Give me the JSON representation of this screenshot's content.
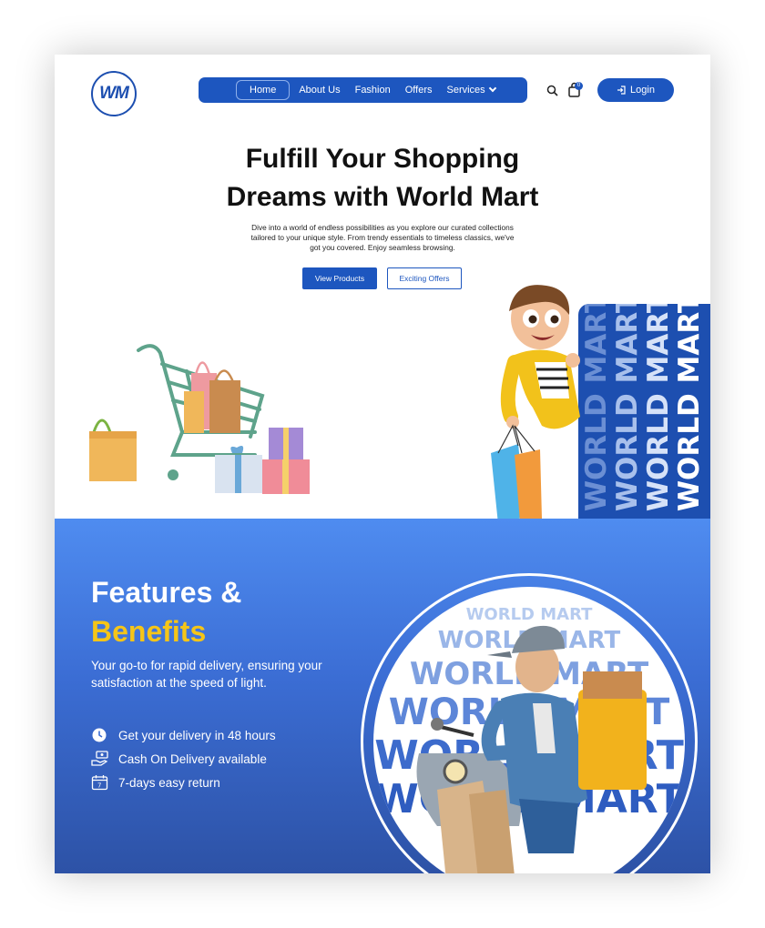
{
  "brand": {
    "logo_text": "WM",
    "primary": "#1d56bf",
    "accent": "#f5c518"
  },
  "nav": {
    "items": [
      {
        "label": "Home",
        "active": true
      },
      {
        "label": "About Us"
      },
      {
        "label": "Fashion"
      },
      {
        "label": "Offers"
      },
      {
        "label": "Services",
        "dropdown": true
      }
    ],
    "cart_count": "0",
    "login_label": "Login"
  },
  "hero": {
    "title_line1": "Fulfill Your Shopping",
    "title_line2": "Dreams with World Mart",
    "subtitle": "Dive into a world of endless possibilities as you explore our curated collections tailored to your unique style. From trendy essentials to timeless classics, we've got you covered. Enjoy seamless browsing.",
    "primary_button": "View Products",
    "secondary_button": "Exciting Offers",
    "banner_word": "WORLD MART"
  },
  "features": {
    "title_white": "Features &",
    "title_yellow": "Benefits",
    "description": "Your go-to for rapid delivery, ensuring your satisfaction at the speed of light.",
    "items": [
      {
        "icon": "clock-icon",
        "label": "Get your delivery in 48 hours"
      },
      {
        "icon": "cash-hand-icon",
        "label": "Cash On Delivery available"
      },
      {
        "icon": "calendar-icon",
        "label": "7-days easy return"
      }
    ],
    "watermark": "WORLD MART"
  }
}
